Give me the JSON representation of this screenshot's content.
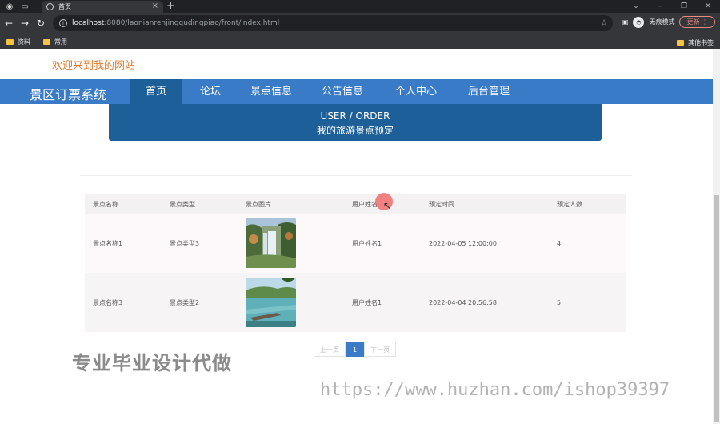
{
  "browser": {
    "tab_title": "首页",
    "new_tab_icon": "plus-icon",
    "url_host": "localhost",
    "url_path": ":8080/laonianrenjingqudingpiao/front/index.html",
    "profile_label": "无痕模式",
    "update_label": "更新",
    "bookmarks": [
      "资料",
      "常用"
    ],
    "other_bookmarks": "其他书签"
  },
  "site": {
    "welcome": "欢迎来到我的网站",
    "brand": "景区订票系统",
    "nav": [
      "首页",
      "论坛",
      "景点信息",
      "公告信息",
      "个人中心",
      "后台管理"
    ],
    "active_nav": "首页"
  },
  "banner": {
    "line1": "USER / ORDER",
    "line2": "我的旅游景点预定"
  },
  "table": {
    "headers": [
      "景点名称",
      "景点类型",
      "景点图片",
      "用户姓名",
      "预定时间",
      "预定人数"
    ],
    "rows": [
      {
        "name": "景点名称1",
        "type": "景点类型3",
        "image": "waterfall-photo",
        "user": "用户姓名1",
        "time": "2022-04-05 12:00:00",
        "count": "4"
      },
      {
        "name": "景点名称3",
        "type": "景点类型2",
        "image": "lake-pier-photo",
        "user": "用户姓名1",
        "time": "2022-04-04 20:56:58",
        "count": "5"
      }
    ]
  },
  "pager": {
    "prev": "上一页",
    "current": "1",
    "next": "下一页"
  },
  "watermarks": {
    "text1": "专业毕业设计代做",
    "text2": "https://www.huzhan.com/ishop39397"
  },
  "colors": {
    "nav_bg": "#3a7bc8",
    "nav_active": "#1d5f99",
    "welcome": "#e07a2e"
  }
}
